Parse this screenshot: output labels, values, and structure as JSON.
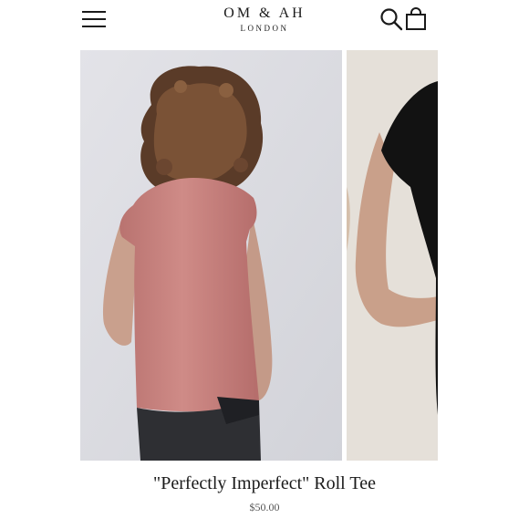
{
  "header": {
    "brand_name": "Om & Ah",
    "brand_sub": "London"
  },
  "product": {
    "title": "\"Perfectly Imperfect\" Roll Tee",
    "price": "$50.00"
  },
  "icons": {
    "menu": "hamburger-menu-icon",
    "search": "search-icon",
    "cart": "shopping-bag-icon"
  },
  "colors": {
    "text": "#1a1a1a",
    "tee_color": "#c7827f",
    "alt_tee_color": "#111111"
  }
}
